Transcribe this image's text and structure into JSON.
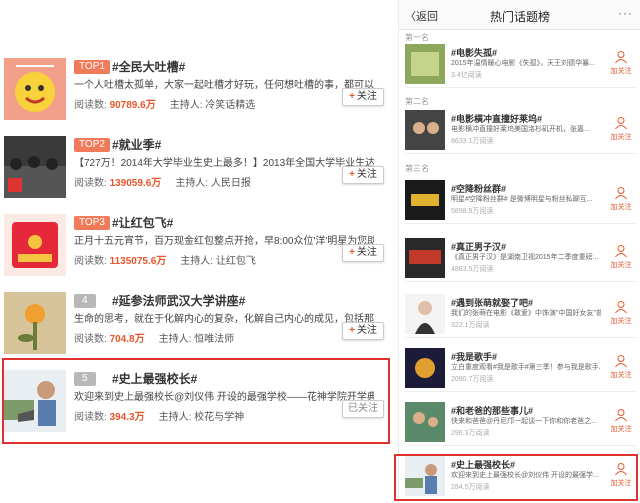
{
  "left": {
    "items": [
      {
        "rank": "TOP1",
        "title": "#全民大吐槽#",
        "desc": "一个人吐槽太孤单，大家一起吐槽才好玩，任何想吐槽的事，都可以被…",
        "read_label": "阅读数:",
        "read_count": "90789.6万",
        "host_label": "主持人:",
        "host": "冷笑话精选",
        "follow": "关注"
      },
      {
        "rank": "TOP2",
        "title": "#就业季#",
        "desc": "【727万！2014年大学毕业生史上最多！】2013年全国大学毕业生达到699…",
        "read_label": "阅读数:",
        "read_count": "139059.6万",
        "host_label": "主持人:",
        "host": "人民日报",
        "follow": "关注"
      },
      {
        "rank": "TOP3",
        "title": "#让红包飞#",
        "desc": "正月十五元宵节，百万现金红包整点开抢，早8:00众位'洋'明星为您助…",
        "read_label": "阅读数:",
        "read_count": "1135075.6万",
        "host_label": "主持人:",
        "host": "让红包飞",
        "follow": "关注"
      },
      {
        "rank": "4",
        "title": "#延参法师武汉大学讲座#",
        "desc": "生命的思考，就在于化解内心的复杂，化解自己内心的成见，包括那些…",
        "read_label": "阅读数:",
        "read_count": "704.8万",
        "host_label": "主持人:",
        "host": "恒唯法师",
        "follow": "关注"
      },
      {
        "rank": "5",
        "title": "#史上最强校长#",
        "desc": "欢迎来到史上最强校长@刘仪伟 开设的最强学校——花神学院开学典礼相…",
        "read_label": "阅读数:",
        "read_count": "394.3万",
        "host_label": "主持人:",
        "host": "校花与学神",
        "follow": "已关注"
      }
    ]
  },
  "right": {
    "back": "返回",
    "title": "热门话题榜",
    "more": "···",
    "sections": [
      "第一名",
      "第二名",
      "第三名"
    ],
    "follow_label": "加关注",
    "items": [
      {
        "title": "#电影失孤#",
        "desc": "2015年温情暖心电影《失孤》，天王刘德华暴...",
        "count": "3.4亿阅读"
      },
      {
        "title": "#电影横冲直撞好莱坞#",
        "desc": "电影横冲直撞好莱坞美国洛杉矶开机，张嘉...",
        "count": "8633.1万阅读"
      },
      {
        "title": "#空降粉丝群#",
        "desc": "明星#空降粉丝群# 是微博明星与粉丝私聊互...",
        "count": "5898.5万阅读"
      },
      {
        "title": "#真正男子汉#",
        "desc": "《真正男子汉》是湖南卫视2015年二季度重磅...",
        "count": "4883.5万阅读"
      },
      {
        "title": "#遇到张萌就娶了吧#",
        "desc": "我们的张萌在电影《敢爱》中饰演\"中国好女友\"普...",
        "count": "322.1万阅读"
      },
      {
        "title": "#我是歌手#",
        "desc": "立白重度观看#我是歌手#第三季！参与我是歌手...",
        "count": "2090.7万阅读"
      },
      {
        "title": "#和老爸的那些事儿#",
        "desc": "快来和爸爸@丹尼邝一起谈一下你和你老爸之...",
        "count": "296.3万阅读"
      },
      {
        "title": "#史上最强校长#",
        "desc": "欢迎来到史上最强校长@刘仪伟 开设的最强学...",
        "count": "284.5万阅读"
      }
    ]
  },
  "colors": {
    "accent": "#e8562b",
    "highlight": "#e03030",
    "top_badge": "#f07a5a",
    "num_badge": "#b8b8b8"
  }
}
